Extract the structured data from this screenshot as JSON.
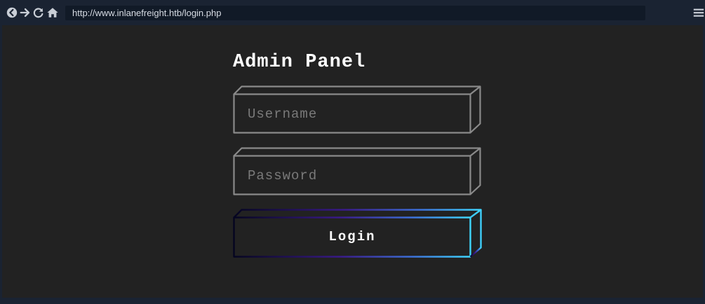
{
  "browser": {
    "url": "http://www.inlanefreight.htb/login.php",
    "nav_icons": [
      "back-icon",
      "forward-icon",
      "reload-icon",
      "home-icon"
    ],
    "menu_icon": "hamburger-menu-icon"
  },
  "panel": {
    "title": "Admin Panel",
    "username_placeholder": "Username",
    "password_placeholder": "Password",
    "login_label": "Login"
  },
  "colors": {
    "page_background": "#222222",
    "browser_chrome": "#1a2332",
    "field_border": "#8a8a8a",
    "button_gradient_start": "#0a0a2a",
    "button_gradient_mid": "#3a1a8a",
    "button_gradient_end": "#3fd7ff"
  }
}
